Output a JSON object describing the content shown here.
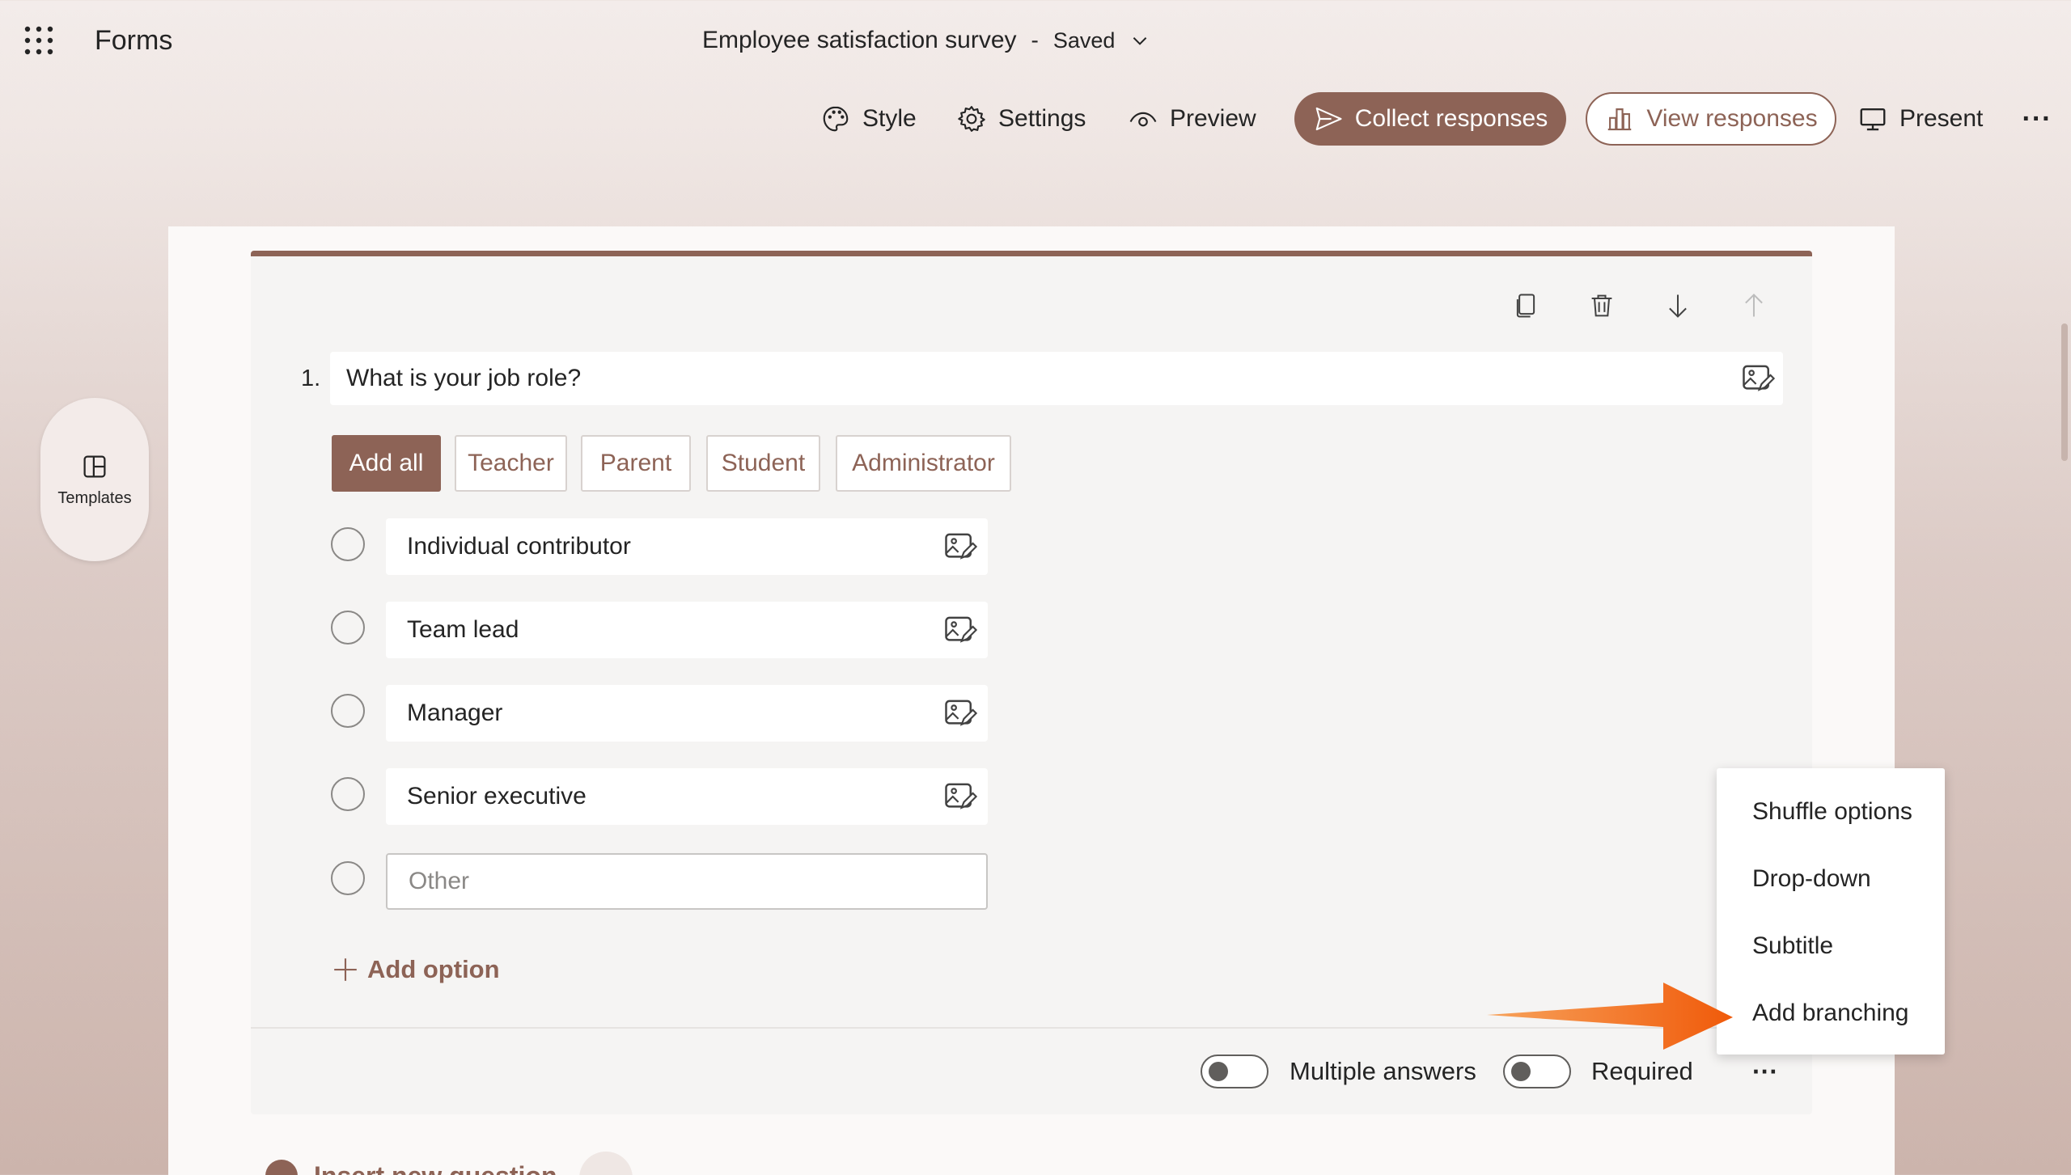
{
  "app": {
    "name": "Forms"
  },
  "header": {
    "title": "Employee satisfaction survey",
    "separator": "-",
    "status": "Saved"
  },
  "toolbar": {
    "style": "Style",
    "settings": "Settings",
    "preview": "Preview",
    "collect": "Collect responses",
    "view": "View responses",
    "present": "Present",
    "more": "···"
  },
  "sidebar": {
    "templates_label": "Templates"
  },
  "question": {
    "number": "1.",
    "text": "What is your job role?",
    "suggestions": [
      "Add all",
      "Teacher",
      "Parent",
      "Student",
      "Administrator"
    ],
    "options": [
      "Individual contributor",
      "Team lead",
      "Manager",
      "Senior executive"
    ],
    "other_placeholder": "Other",
    "add_option": "Add option",
    "multiple_answers_label": "Multiple answers",
    "required_label": "Required",
    "more": "···"
  },
  "menu": {
    "items": [
      "Shuffle options",
      "Drop-down",
      "Subtitle",
      "Add branching"
    ]
  },
  "footer": {
    "insert_label": "Insert new question"
  },
  "colors": {
    "accent": "#8d6356",
    "arrow": "#f06a12"
  }
}
